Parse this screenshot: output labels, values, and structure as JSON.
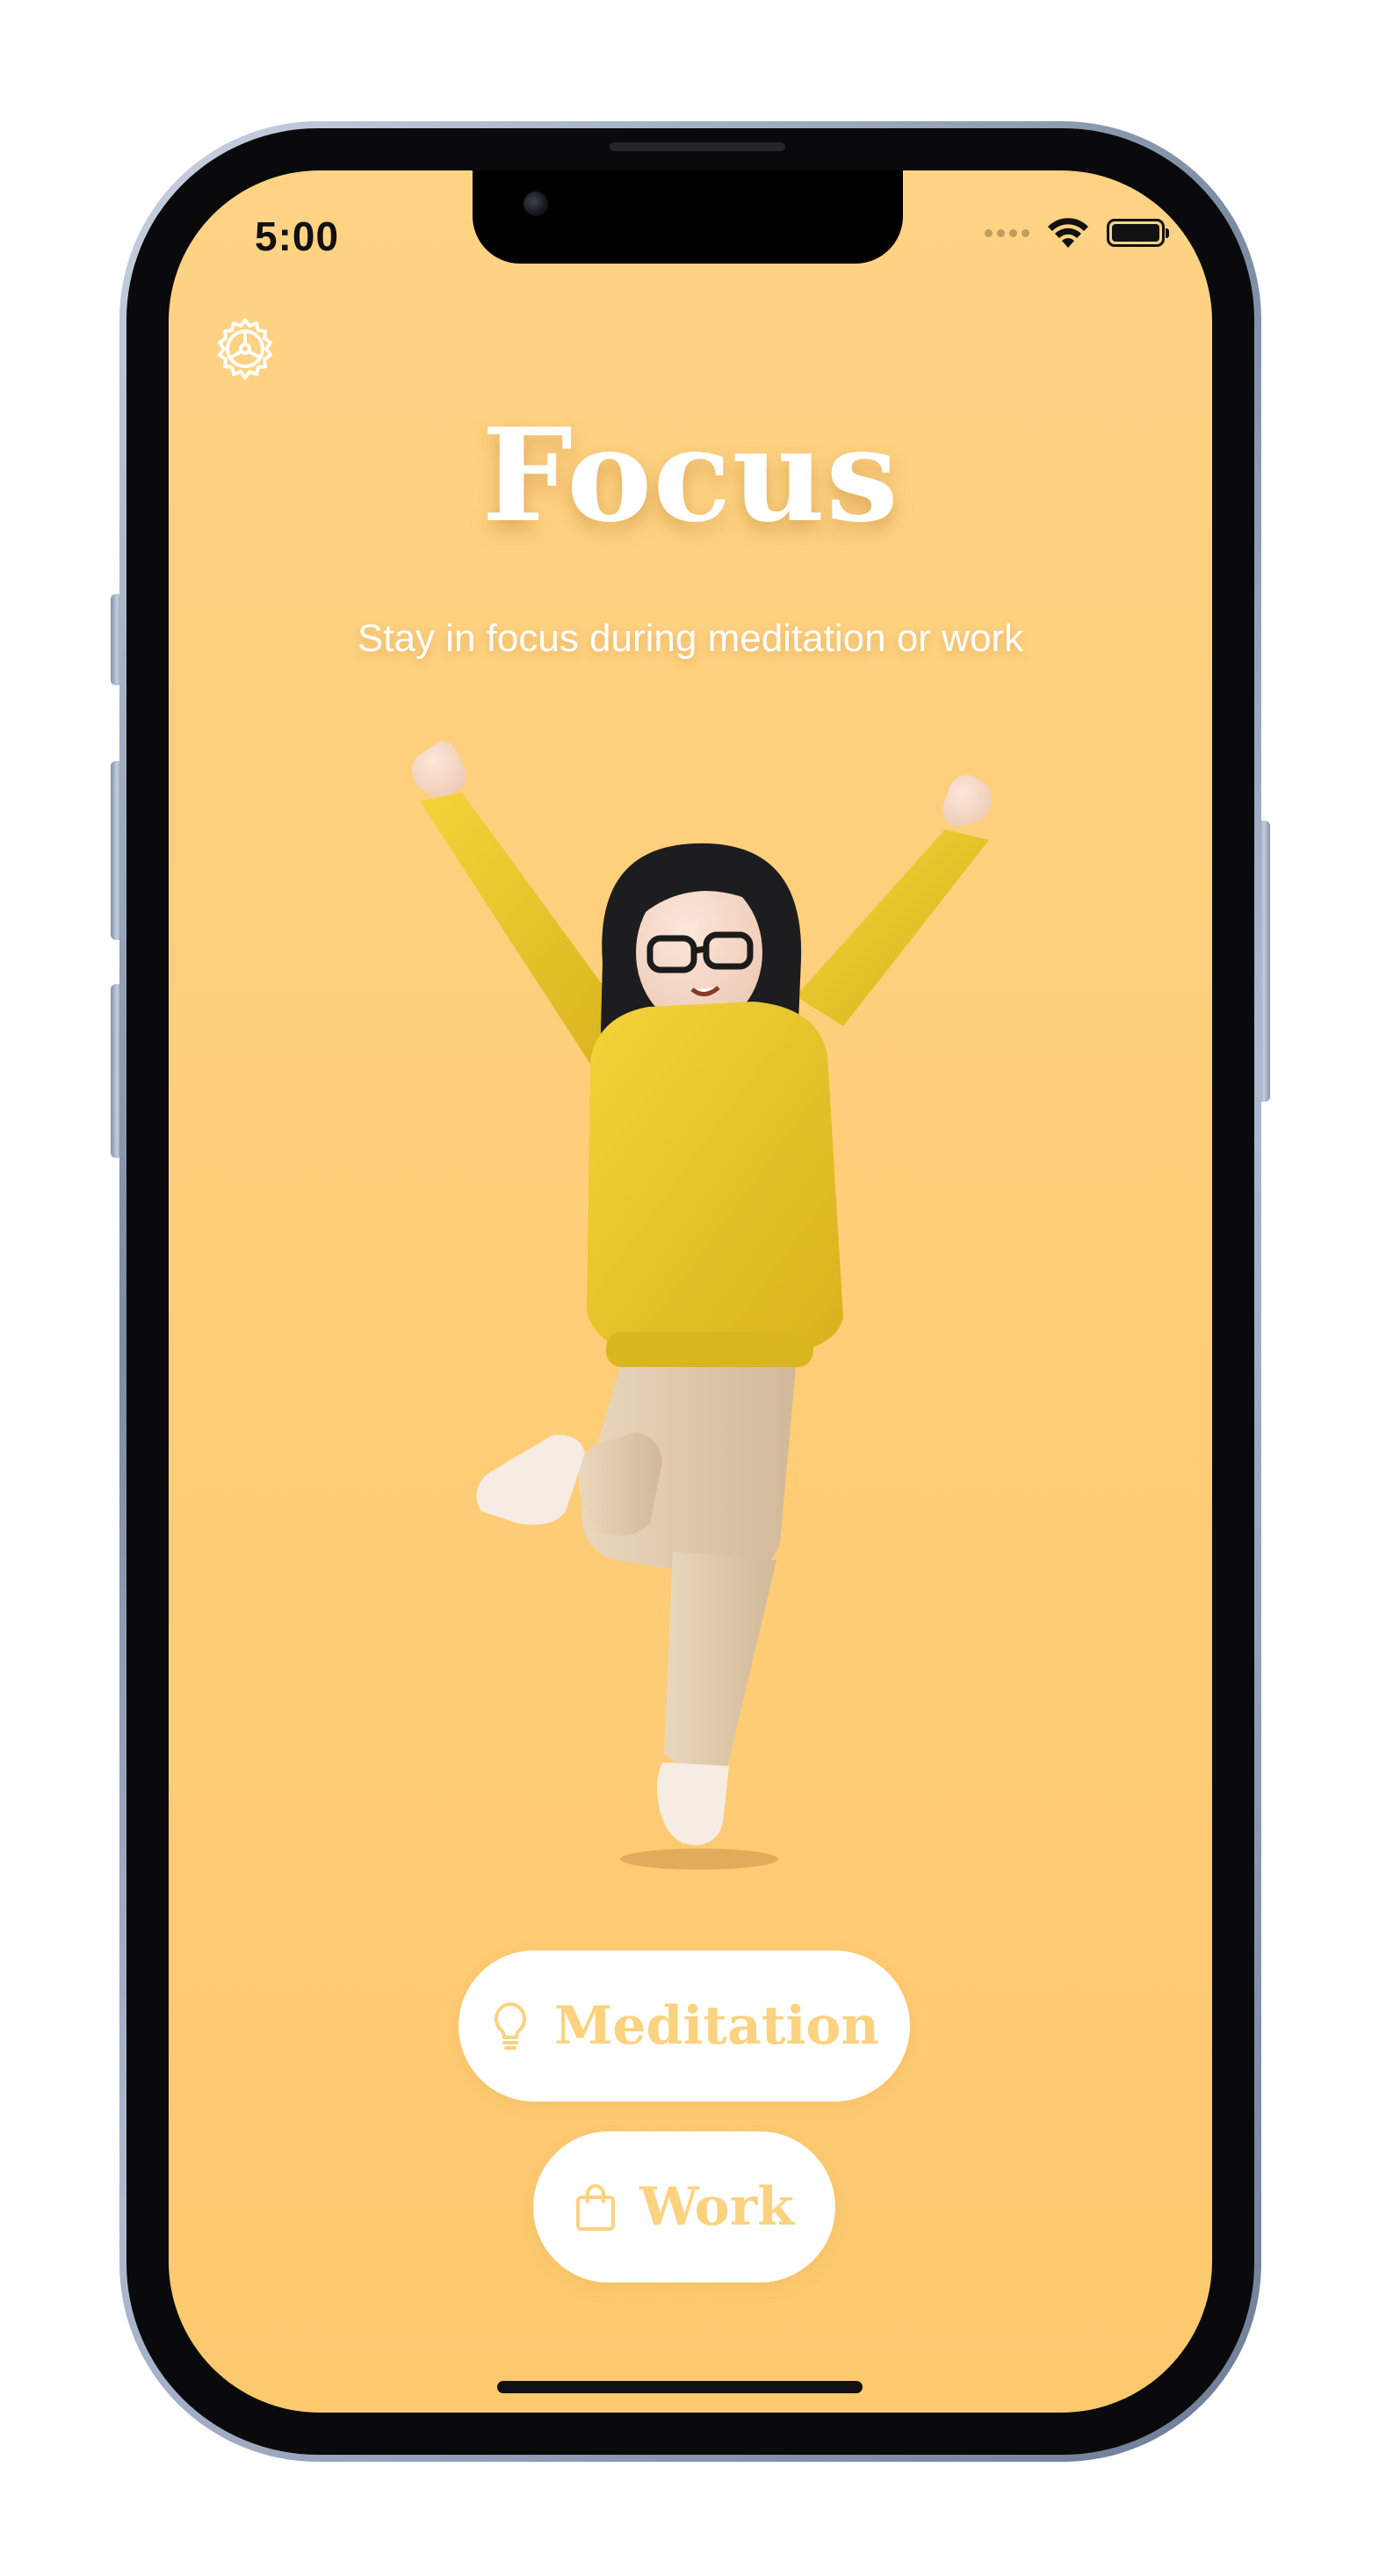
{
  "status_bar": {
    "time": "5:00",
    "icons": [
      "signal-dots-icon",
      "wifi-icon",
      "battery-icon"
    ]
  },
  "header": {
    "settings_icon": "gear-icon",
    "title": "Focus",
    "subtitle": "Stay in focus during meditation or work"
  },
  "illustration": {
    "subject": "3D character jumping with arms raised, wearing yellow sweater and beige pants"
  },
  "actions": {
    "meditation": {
      "label": "Meditation",
      "icon": "lightbulb-icon"
    },
    "work": {
      "label": "Work",
      "icon": "shopping-bag-icon"
    }
  },
  "colors": {
    "background_top": "#fed384",
    "background_bottom": "#fdc96f",
    "button_background": "#ffffff",
    "button_text": "#fbd27f",
    "title_text": "#ffffff"
  }
}
